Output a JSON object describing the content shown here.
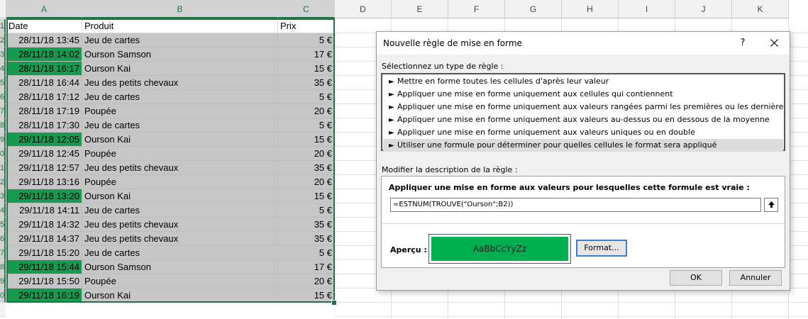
{
  "spreadsheet": {
    "columns": [
      "A",
      "B",
      "C",
      "D",
      "E",
      "F",
      "G",
      "H",
      "I",
      "J",
      "K"
    ],
    "header_row": {
      "date": "Date",
      "produit": "Produit",
      "prix": "Prix"
    },
    "row_numbers": [
      "",
      "1",
      "2",
      "3",
      "4",
      "5",
      "6",
      "7",
      "8",
      "9",
      "0",
      "1",
      "2",
      "3",
      "4",
      "5",
      "6",
      "7",
      "8",
      "9",
      "0",
      ""
    ],
    "rows": [
      {
        "date": "28/11/18 13:45",
        "produit": "Jeu de cartes",
        "prix": "5 €",
        "highlighted": false
      },
      {
        "date": "28/11/18 14:02",
        "produit": "Ourson Samson",
        "prix": "17 €",
        "highlighted": true
      },
      {
        "date": "28/11/18 16:17",
        "produit": "Ourson Kai",
        "prix": "15 €",
        "highlighted": true
      },
      {
        "date": "28/11/18 16:44",
        "produit": "Jeu des petits chevaux",
        "prix": "35 €",
        "highlighted": false
      },
      {
        "date": "28/11/18 17:12",
        "produit": "Jeu de cartes",
        "prix": "5 €",
        "highlighted": false
      },
      {
        "date": "28/11/18 17:19",
        "produit": "Poupée",
        "prix": "20 €",
        "highlighted": false
      },
      {
        "date": "28/11/18 17:30",
        "produit": "Jeu de cartes",
        "prix": "5 €",
        "highlighted": false
      },
      {
        "date": "29/11/18 12:05",
        "produit": "Ourson Kai",
        "prix": "15 €",
        "highlighted": true
      },
      {
        "date": "29/11/18 12:45",
        "produit": "Poupée",
        "prix": "20 €",
        "highlighted": false
      },
      {
        "date": "29/11/18 12:57",
        "produit": "Jeu des petits chevaux",
        "prix": "35 €",
        "highlighted": false
      },
      {
        "date": "29/11/18 13:16",
        "produit": "Poupée",
        "prix": "20 €",
        "highlighted": false
      },
      {
        "date": "29/11/18 13:20",
        "produit": "Ourson Kai",
        "prix": "15 €",
        "highlighted": true
      },
      {
        "date": "29/11/18 14:11",
        "produit": "Jeu de cartes",
        "prix": "5 €",
        "highlighted": false
      },
      {
        "date": "29/11/18 14:32",
        "produit": "Jeu des petits chevaux",
        "prix": "35 €",
        "highlighted": false
      },
      {
        "date": "29/11/18 14:37",
        "produit": "Jeu des petits chevaux",
        "prix": "35 €",
        "highlighted": false
      },
      {
        "date": "29/11/18 15:20",
        "produit": "Jeu de cartes",
        "prix": "5 €",
        "highlighted": false
      },
      {
        "date": "29/11/18 15:44",
        "produit": "Ourson Samson",
        "prix": "17 €",
        "highlighted": true
      },
      {
        "date": "29/11/18 15:50",
        "produit": "Poupée",
        "prix": "20 €",
        "highlighted": false
      },
      {
        "date": "29/11/18 16:19",
        "produit": "Ourson Kai",
        "prix": "15 €",
        "highlighted": true
      }
    ],
    "colors": {
      "highlight": "#169b4e",
      "selection_fill": "#c6c6c6",
      "selection_border": "#217346"
    }
  },
  "dialog": {
    "title": "Nouvelle règle de mise en forme",
    "help_label": "?",
    "select_type_label": "Sélectionnez un type de règle :",
    "rule_types": [
      "Mettre en forme toutes les cellules d'après leur valeur",
      "Appliquer une mise en forme uniquement aux cellules qui contiennent",
      "Appliquer une mise en forme uniquement aux valeurs rangées parmi les premières ou les dernières valeurs",
      "Appliquer une mise en forme uniquement aux valeurs au-dessus ou en dessous de la moyenne",
      "Appliquer une mise en forme uniquement aux valeurs uniques ou en double",
      "Utiliser une formule pour déterminer pour quelles cellules le format sera appliqué"
    ],
    "selected_rule_index": 5,
    "edit_description_label": "Modifier la description de la règle :",
    "formula_title": "Appliquer une mise en forme aux valeurs pour lesquelles cette formule est vraie :",
    "formula_value": "=ESTNUM(TROUVE(\"Ourson\";B2))",
    "preview_label": "Aperçu :",
    "preview_text": "AaBbCcYyZz",
    "preview_color": "#00b050",
    "format_button": "Format...",
    "ok_button": "OK",
    "cancel_button": "Annuler"
  }
}
